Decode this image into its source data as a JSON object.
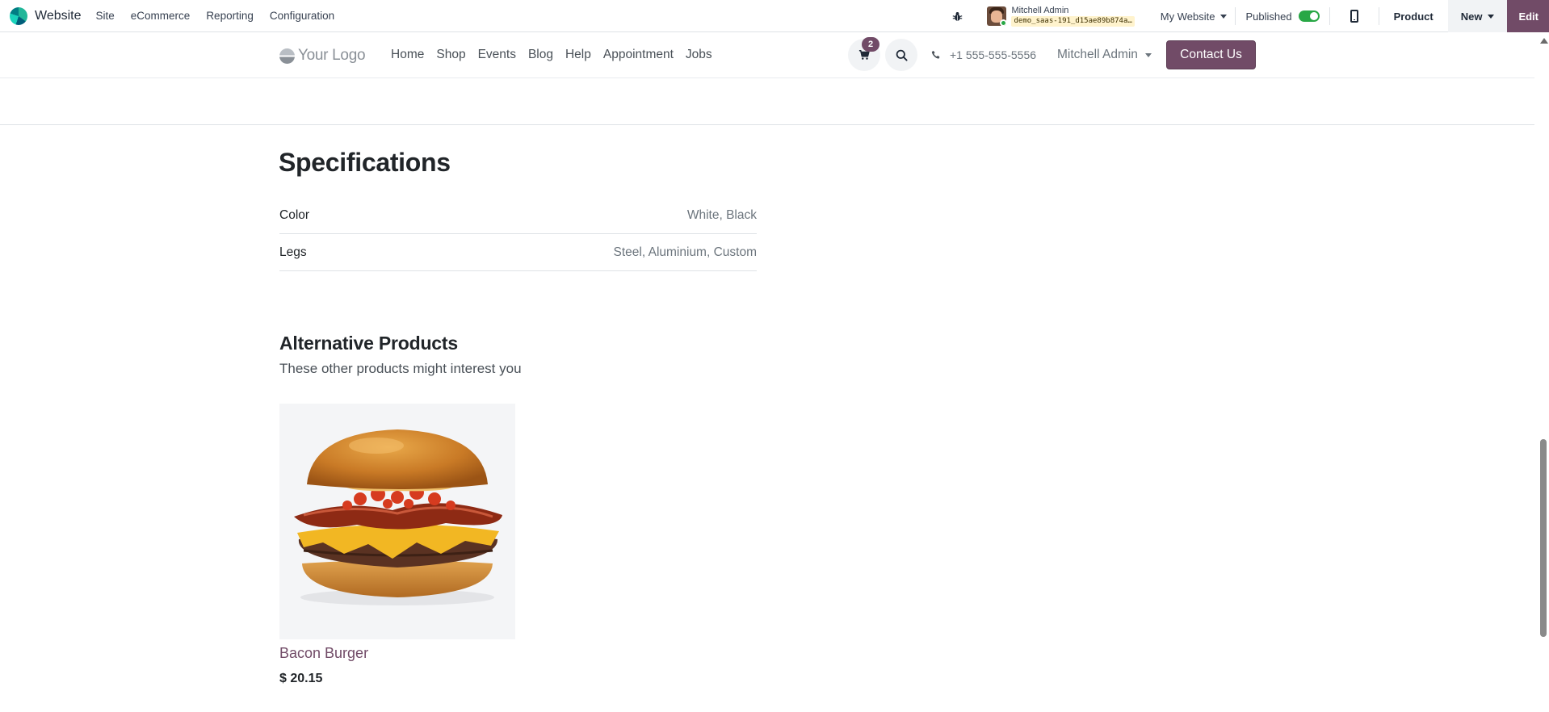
{
  "admin_bar": {
    "app_name": "Website",
    "menus": [
      "Site",
      "eCommerce",
      "Reporting",
      "Configuration"
    ],
    "user_name": "Mitchell Admin",
    "database": "demo_saas-191_d15ae89b874a…",
    "website_switcher": "My Website",
    "published_label": "Published",
    "published": true,
    "product_label": "Product",
    "new_label": "New",
    "edit_label": "Edit"
  },
  "site_header": {
    "logo_text": "Your Logo",
    "nav": [
      "Home",
      "Shop",
      "Events",
      "Blog",
      "Help",
      "Appointment",
      "Jobs"
    ],
    "cart_count": "2",
    "phone": "+1 555-555-5556",
    "user_menu": "Mitchell Admin",
    "contact_label": "Contact Us"
  },
  "specifications": {
    "title": "Specifications",
    "rows": [
      {
        "key": "Color",
        "value": "White, Black"
      },
      {
        "key": "Legs",
        "value": "Steel, Aluminium, Custom"
      }
    ]
  },
  "alternatives": {
    "title": "Alternative Products",
    "subtitle": "These other products might interest you",
    "products": [
      {
        "name": "Bacon Burger",
        "price": "$ 20.15"
      }
    ]
  },
  "colors": {
    "brand": "#714b67",
    "toggle_on": "#28a745"
  }
}
